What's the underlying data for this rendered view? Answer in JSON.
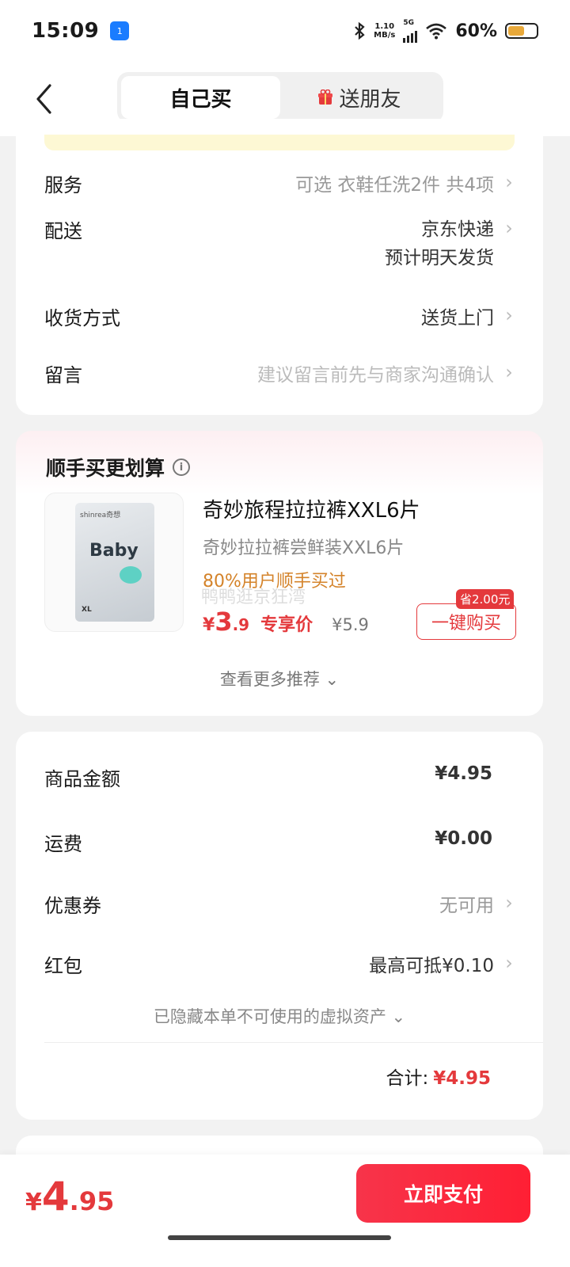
{
  "status_bar": {
    "time": "15:09",
    "app_badge": "1",
    "net_speed_value": "1.10",
    "net_speed_unit": "MB/s",
    "network": "5G",
    "battery": "60%"
  },
  "nav": {
    "tab_self": "自己买",
    "tab_gift": "送朋友"
  },
  "order_options": {
    "service_label": "服务",
    "service_value": "可选 衣鞋任洗2件 共4项",
    "delivery_label": "配送",
    "delivery_value_line1": "京东快递",
    "delivery_value_line2": "预计明天发货",
    "receive_label": "收货方式",
    "receive_value": "送货上门",
    "message_label": "留言",
    "message_placeholder": "建议留言前先与商家沟通确认"
  },
  "upsell": {
    "title": "顺手买更划算",
    "product_name": "奇妙旅程拉拉裤XXL6片",
    "product_sub": "奇妙拉拉裤尝鲜装XXL6片",
    "tag": "80%用户顺手买过",
    "watermark": "鸭鸭逛京狂湾",
    "price_currency": "¥",
    "price_int": "3",
    "price_dec": ".9",
    "exclusive_label": "专享价",
    "original_price": "¥5.9",
    "save_badge": "省2.00元",
    "one_click_label": "一键购买",
    "more_label": "查看更多推荐 ⌄",
    "pkg_brand": "shinrea奇想",
    "pkg_word": "Baby",
    "pkg_size": "XL"
  },
  "summary": {
    "goods_label": "商品金额",
    "goods_value": "¥4.95",
    "shipping_label": "运费",
    "shipping_value": "¥0.00",
    "coupon_label": "优惠券",
    "coupon_value": "无可用",
    "redpack_label": "红包",
    "redpack_value": "最高可抵¥0.10",
    "hidden_assets": "已隐藏本单不可使用的虚拟资产 ⌄",
    "total_label": "合计:",
    "total_value": "¥4.95"
  },
  "bottom": {
    "currency": "¥",
    "price_int": "4",
    "price_dec": ".95",
    "pay_label": "立即支付"
  },
  "colors": {
    "accent": "#e4393c",
    "tag_orange": "#d4832a",
    "background": "#f2f2f2"
  }
}
